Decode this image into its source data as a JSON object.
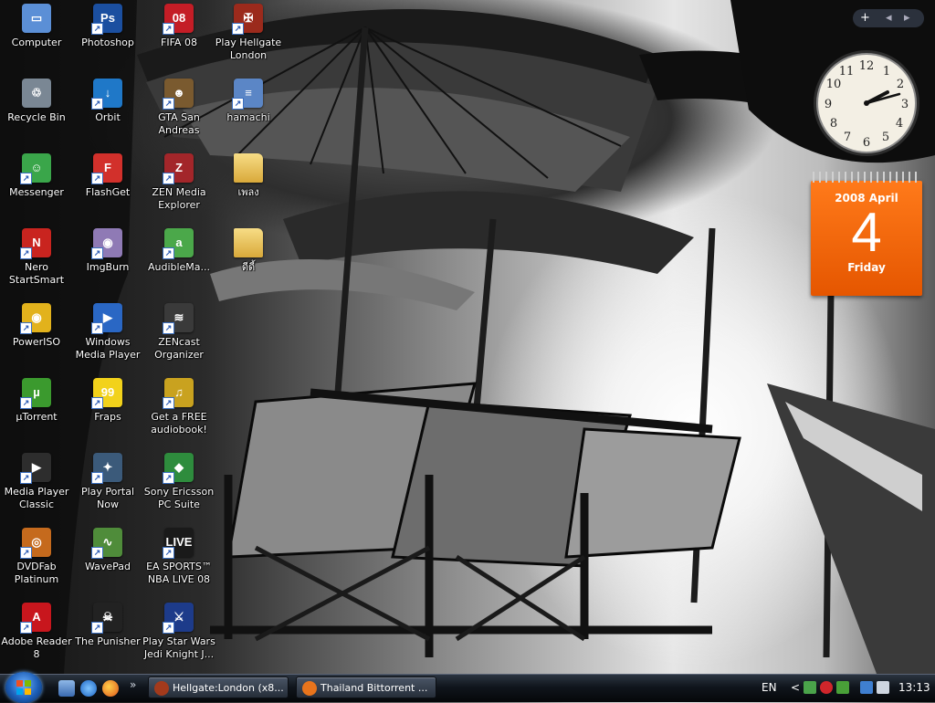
{
  "desktop_icons": [
    {
      "label": "Computer",
      "color": "#5b8fd6",
      "glyph": "▭"
    },
    {
      "label": "Recycle Bin",
      "color": "#7a8794",
      "glyph": "♲"
    },
    {
      "label": "Messenger",
      "color": "#3aa64a",
      "glyph": "☺"
    },
    {
      "label": "Nero StartSmart",
      "color": "#c9241f",
      "glyph": "N"
    },
    {
      "label": "PowerISO",
      "color": "#e2b21c",
      "glyph": "◉"
    },
    {
      "label": "µTorrent",
      "color": "#3b9a2e",
      "glyph": "µ"
    },
    {
      "label": "Media Player Classic",
      "color": "#2d2d2d",
      "glyph": "▶"
    },
    {
      "label": "DVDFab Platinum",
      "color": "#c56a1d",
      "glyph": "◎"
    },
    {
      "label": "Adobe Reader 8",
      "color": "#c8161d",
      "glyph": "A"
    },
    {
      "label": "Photoshop",
      "color": "#1b4fa0",
      "glyph": "Ps"
    },
    {
      "label": "Orbit",
      "color": "#1f78c8",
      "glyph": "↓"
    },
    {
      "label": "FlashGet",
      "color": "#d2302b",
      "glyph": "F"
    },
    {
      "label": "ImgBurn",
      "color": "#8f7ab5",
      "glyph": "◉"
    },
    {
      "label": "Windows Media Player",
      "color": "#2a67c4",
      "glyph": "▶"
    },
    {
      "label": "Fraps",
      "color": "#f2d21b",
      "glyph": "99"
    },
    {
      "label": "Play Portal Now",
      "color": "#3b5a7a",
      "glyph": "✦"
    },
    {
      "label": "WavePad",
      "color": "#4f8c3a",
      "glyph": "∿"
    },
    {
      "label": "The Punisher",
      "color": "#222222",
      "glyph": "☠"
    },
    {
      "label": "FIFA 08",
      "color": "#c41d26",
      "glyph": "08"
    },
    {
      "label": "GTA San Andreas",
      "color": "#7a5a2f",
      "glyph": "☻"
    },
    {
      "label": "ZEN Media Explorer",
      "color": "#a3262a",
      "glyph": "Z"
    },
    {
      "label": "AudibleMa...",
      "color": "#4ba84a",
      "glyph": "a"
    },
    {
      "label": "ZENcast Organizer",
      "color": "#3a3a3a",
      "glyph": "≋"
    },
    {
      "label": "Get a FREE audiobook!",
      "color": "#c9a21f",
      "glyph": "♫"
    },
    {
      "label": "Sony Ericsson PC Suite",
      "color": "#2e8c3d",
      "glyph": "◆"
    },
    {
      "label": "EA SPORTS™ NBA LIVE 08",
      "color": "#1a1a1a",
      "glyph": "LIVE"
    },
    {
      "label": "Play Star Wars Jedi Knight J...",
      "color": "#1d3b8a",
      "glyph": "⚔"
    },
    {
      "label": "Play Hellgate London",
      "color": "#9b2a1c",
      "glyph": "✠"
    },
    {
      "label": "hamachi",
      "color": "#5b86c6",
      "glyph": "≡"
    },
    {
      "label": "เพลง",
      "color": "#e8c45a",
      "glyph": ""
    },
    {
      "label": "ดีดี้",
      "color": "#e8c45a",
      "glyph": ""
    }
  ],
  "gadgets": {
    "sidebar_add": "+",
    "clock": {
      "time": "13:13"
    },
    "calendar": {
      "month_line": "2008 April",
      "day": "4",
      "weekday": "Friday"
    }
  },
  "taskbar": {
    "quick_launch_more": "»",
    "tasks": [
      {
        "label": "Hellgate:London (x8...",
        "icon_color": "#a33a1c"
      },
      {
        "label": "Thailand Bittorrent ...",
        "icon_color": "#e8741c"
      }
    ],
    "language": "EN",
    "tray_chevron": "<",
    "clock": "13:13"
  }
}
